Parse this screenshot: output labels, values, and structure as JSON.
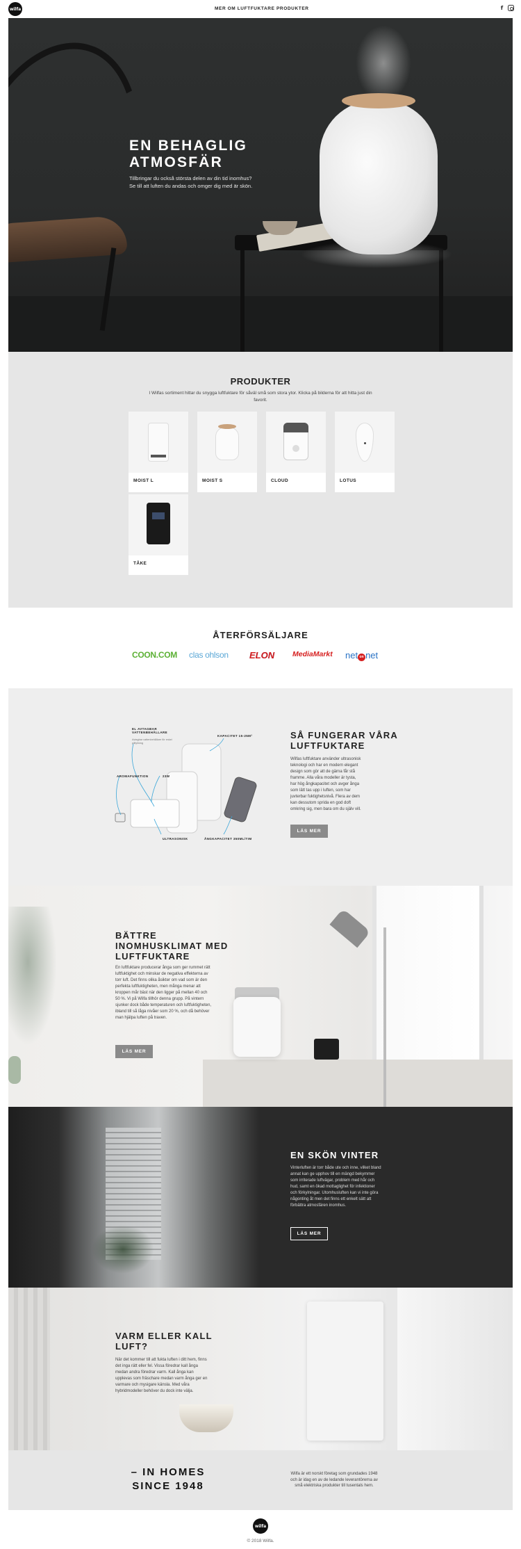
{
  "header": {
    "logo": "wilfa",
    "nav": [
      "MER OM LUFTFUKTARE",
      "PRODUKTER"
    ],
    "social_icons": [
      "facebook-icon",
      "instagram-icon"
    ]
  },
  "hero": {
    "title": "EN BEHAGLIG ATMOSFÄR",
    "text": "Tillbringar du också största delen av din tid inomhus? Se till att luften du andas och omger dig med är skön."
  },
  "products": {
    "title": "PRODUKTER",
    "subtitle": "I Wilfas sortiment hittar du snygga luftfuktare för såväl små som stora ytor. Klicka på bilderna för att hitta just din favorit.",
    "items": [
      {
        "name": "MOIST L"
      },
      {
        "name": "MOIST S"
      },
      {
        "name": "CLOUD"
      },
      {
        "name": "LOTUS"
      },
      {
        "name": "TÅKE"
      }
    ]
  },
  "retailers": {
    "title": "ÅTERFÖRSÄLJARE",
    "logos": [
      "COON.COM",
      "clas ohlson",
      "ELON",
      "MediaMarkt",
      "net",
      "on",
      "net"
    ]
  },
  "how": {
    "title": "SÅ FUNGERAR VÅRA LUFTFUKTARE",
    "text": "Wilfas luftfuktare använder ultrasonisk teknologi och har en modern elegant design som gör att de gärna får stå framme. Alla våra modeller är tysta, har hög ångkapacitet och avger ånga som lätt tas upp i luften, som har juvterbar fuktighetsnivå. Flera av dem kan dessutom sprida en god doft omkring sig, men bara om du själv vill.",
    "button": "LÄS MER",
    "diagram": {
      "labels": [
        "EL AVTAGBAR VATTENBEHÅLLARE",
        "KAPACITET 15-25M²",
        "AROMAFUNKTION",
        "23W",
        "ULTRASONISK",
        "ÅNGKAPACITET 350ML/TIM"
      ],
      "note": "Avtagbar vattenbehållare för enkel påfyllning"
    }
  },
  "better": {
    "title": "BÄTTRE INOMHUSKLIMAT MED LUFTFUKTARE",
    "text": "En luftfuktare producerar ånga som ger rummet rätt luftfuktighet och minskar de negativa effekterna av torr luft. Det finns olika åsikter om vad som är den perfekta luftfuktigheten, men många menar att kroppen mår bäst när den ligger på mellan 40 och 50 %. Vi på Wilfa tillhör denna grupp. På vintern sjunker dock både temperaturen och luftfuktigheten, ibland till så låga nivåer som 20 %, och då behöver man hjälpa luften på traven.",
    "button": "LÄS MER"
  },
  "winter": {
    "title": "EN SKÖN VINTER",
    "text": "Vinterluften är torr både ute och inne, vilket bland annat kan ge upphov till en mängd bekymmer som irriterade luftvägar, problem med hår och hud, samt en ökad mottaglighet för infektioner och förkylningar. Utomhusluften kan vi inte göra någonting åt men det finns ett enkelt sätt att förbättra atmosfären inomhus.",
    "button": "LÄS MER"
  },
  "warm": {
    "title": "VARM ELLER KALL LUFT?",
    "text": "När det kommer till att fukta luften i ditt hem, finns det inga rätt eller fel. Vissa föredrar kall ånga medan andra föredrar varm. Kall ånga kan upplevas som fräschare medan varm ånga ger en varmare och mysigare känsla. Med våra hybridmodeller behöver du dock inte välja."
  },
  "homes": {
    "title": "– IN HOMES SINCE 1948",
    "text": "Wilfa är ett norskt företag som grundades 1948 och är idag en av de ledande leverantörerna av små elektriska produkter till tusentals hem."
  },
  "footer": {
    "logo": "wilfa",
    "copyright": "© 2018 Wilfa."
  },
  "colors": {
    "dark_section": "#2a2a2a",
    "light_section": "#e6e6e6",
    "button_gray": "#8a8a8a"
  }
}
